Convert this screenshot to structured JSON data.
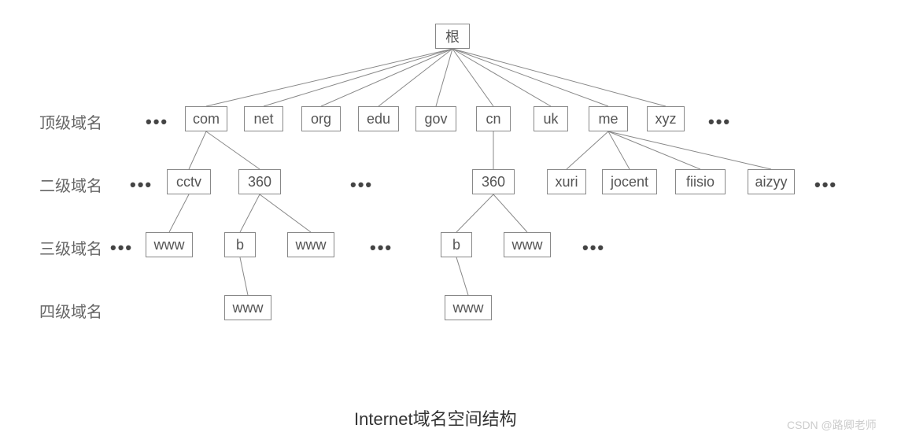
{
  "labels": {
    "level1": "顶级域名",
    "level2": "二级域名",
    "level3": "三级域名",
    "level4": "四级域名"
  },
  "root": "根",
  "level1_nodes": [
    "com",
    "net",
    "org",
    "edu",
    "gov",
    "cn",
    "uk",
    "me",
    "xyz"
  ],
  "level2_nodes": {
    "com_children": [
      "cctv",
      "360"
    ],
    "cn_children": [
      "360"
    ],
    "me_children": [
      "xuri",
      "jocent",
      "fiisio",
      "aizyy"
    ]
  },
  "level3_nodes": {
    "cctv_children": [
      "www"
    ],
    "com360_children": [
      "b",
      "www"
    ],
    "cn360_children": [
      "b",
      "www"
    ]
  },
  "level4_nodes": {
    "com_b_child": "www",
    "cn_b_child": "www"
  },
  "ellipsis": "•••",
  "caption": "Internet域名空间结构",
  "watermark": "CSDN @路卿老师",
  "chart_data": {
    "type": "tree",
    "title": "Internet域名空间结构",
    "levels": [
      "根",
      "顶级域名",
      "二级域名",
      "三级域名",
      "四级域名"
    ],
    "tree": {
      "name": "根",
      "children": [
        {
          "name": "com",
          "children": [
            {
              "name": "cctv",
              "children": [
                {
                  "name": "www"
                }
              ]
            },
            {
              "name": "360",
              "children": [
                {
                  "name": "b",
                  "children": [
                    {
                      "name": "www"
                    }
                  ]
                },
                {
                  "name": "www"
                }
              ]
            }
          ]
        },
        {
          "name": "net"
        },
        {
          "name": "org"
        },
        {
          "name": "edu"
        },
        {
          "name": "gov"
        },
        {
          "name": "cn",
          "children": [
            {
              "name": "360",
              "children": [
                {
                  "name": "b",
                  "children": [
                    {
                      "name": "www"
                    }
                  ]
                },
                {
                  "name": "www"
                }
              ]
            }
          ]
        },
        {
          "name": "uk"
        },
        {
          "name": "me",
          "children": [
            {
              "name": "xuri"
            },
            {
              "name": "jocent"
            },
            {
              "name": "fiisio"
            },
            {
              "name": "aizyy"
            }
          ]
        },
        {
          "name": "xyz"
        }
      ]
    }
  }
}
